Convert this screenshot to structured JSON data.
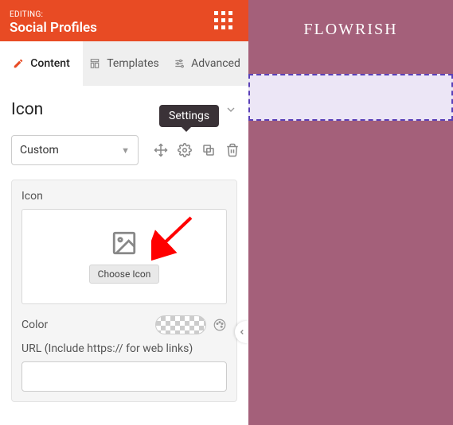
{
  "header": {
    "editing_label": "EDITING:",
    "title": "Social Profiles"
  },
  "tabs": {
    "content": "Content",
    "templates": "Templates",
    "advanced": "Advanced"
  },
  "section": {
    "title": "Icon"
  },
  "toolbar": {
    "dropdown_value": "Custom",
    "tooltip": "Settings"
  },
  "card": {
    "icon_label": "Icon",
    "choose_label": "Choose Icon",
    "color_label": "Color",
    "url_label": "URL (Include https:// for web links)",
    "url_value": ""
  },
  "canvas": {
    "brand": "FLOWRISH"
  }
}
